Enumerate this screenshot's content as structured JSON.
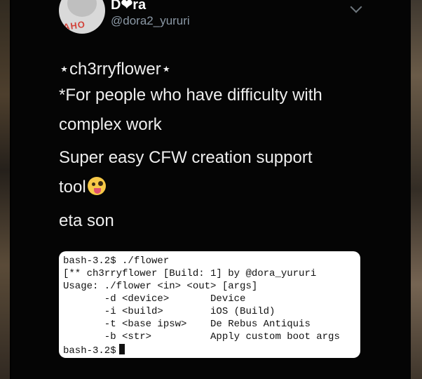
{
  "tweet": {
    "display_name": "D❤ra",
    "handle": "@dora2_yururi",
    "avatar_text": "AHO",
    "lines": [
      "⋆ch3rryflower⋆",
      "*For people who have difficulty with",
      "complex work",
      "Super easy CFW creation support",
      "tool",
      "eta son"
    ]
  },
  "terminal": {
    "lines": [
      "bash-3.2$ ./flower",
      "[** ch3rryflower [Build: 1] by @dora_yururi",
      "Usage: ./flower <in> <out> [args]",
      "       -d <device>       Device",
      "       -i <build>        iOS (Build)",
      "       -t <base ipsw>    De Rebus Antiquis",
      "       -b <str>          Apply custom boot args",
      "bash-3.2$"
    ]
  }
}
